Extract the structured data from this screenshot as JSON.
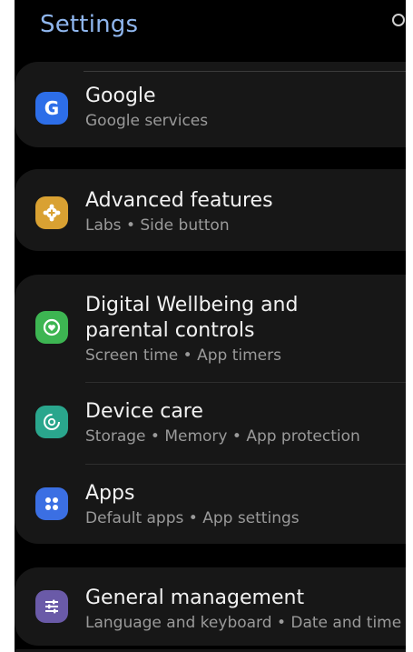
{
  "header": {
    "title": "Settings"
  },
  "items": [
    {
      "title": "Google",
      "subtitle": "Google services",
      "color": "#2d6ee8",
      "icon": "google-icon"
    },
    {
      "title": "Advanced features",
      "subtitle": "Labs  •  Side button",
      "color": "#d9a132",
      "icon": "gear-plus-icon"
    },
    {
      "title": "Digital Wellbeing and parental controls",
      "subtitle": "Screen time  •  App timers",
      "color": "#3db552",
      "icon": "heart-ring-icon"
    },
    {
      "title": "Device care",
      "subtitle": "Storage  •  Memory  •  App protection",
      "color": "#2aa68d",
      "icon": "refresh-ring-icon"
    },
    {
      "title": "Apps",
      "subtitle": "Default apps  •  App settings",
      "color": "#3b6fe3",
      "icon": "four-dots-icon"
    },
    {
      "title": "General management",
      "subtitle": "Language and keyboard  •  Date and time",
      "color": "#6a5aa8",
      "icon": "sliders-icon"
    }
  ]
}
